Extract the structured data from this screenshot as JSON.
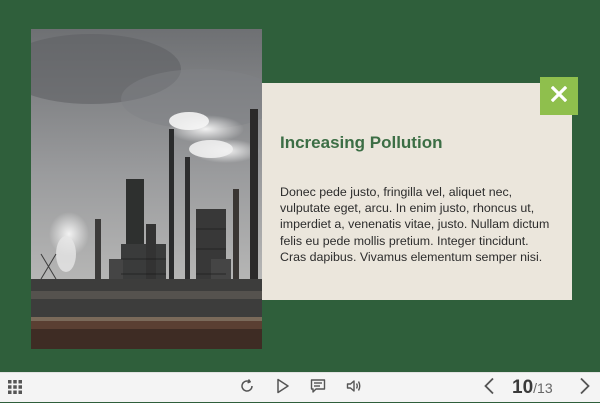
{
  "slide": {
    "title": "Increasing Pollution",
    "body": "Donec pede justo, fringilla vel, aliquet nec, vulputate eget, arcu. In enim justo, rhoncus ut, imperdiet a, venenatis vitae, justo. Nullam dictum felis eu pede mollis pretium. Integer tincidunt. Cras dapibus. Vivamus elementum semper nisi.",
    "image_icon": "industrial-smokestacks-photo",
    "close_icon": "close-icon"
  },
  "toolbar": {
    "menu_icon": "grid-menu-icon",
    "replay_icon": "replay-icon",
    "play_icon": "play-icon",
    "notes_icon": "notes-icon",
    "audio_icon": "speaker-icon",
    "prev_icon": "chevron-left-icon",
    "next_icon": "chevron-right-icon"
  },
  "pager": {
    "current": "10",
    "separator": "/",
    "total": "13"
  },
  "colors": {
    "background": "#2f5f3b",
    "card": "#ebe6dc",
    "accent": "#8fbf4d",
    "title": "#3c6e45"
  }
}
